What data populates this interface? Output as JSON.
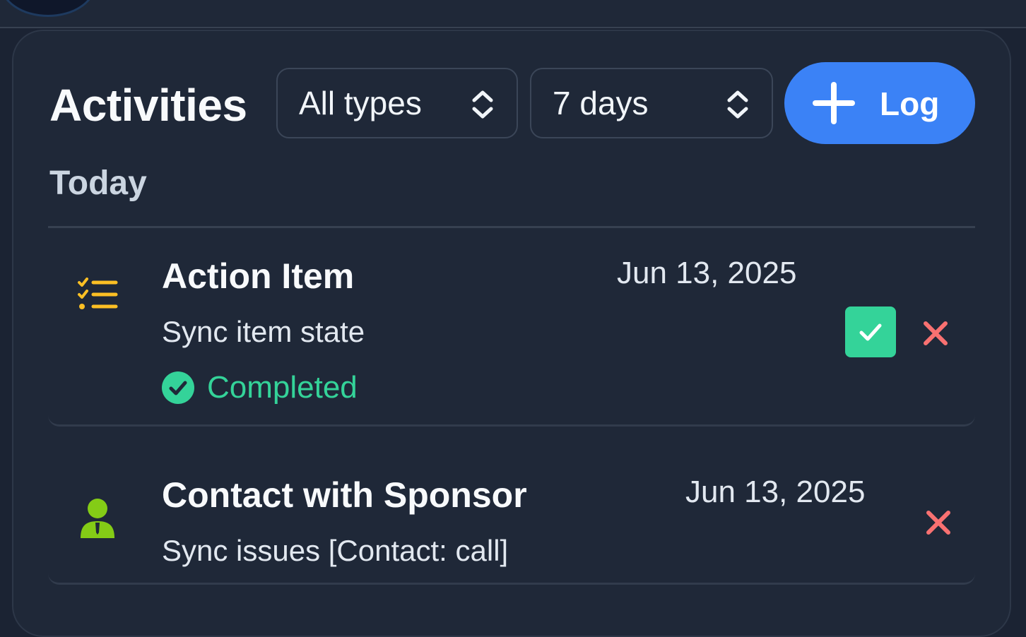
{
  "panel": {
    "title": "Activities",
    "filters": {
      "type_value": "All types",
      "range_value": "7 days"
    },
    "log_button": "Log"
  },
  "section": {
    "title": "Today"
  },
  "activities": [
    {
      "icon": "checklist-icon",
      "title": "Action Item",
      "description": "Sync item state",
      "date": "Jun 13, 2025",
      "status": "Completed"
    },
    {
      "icon": "person-icon",
      "title": "Contact with Sponsor",
      "description": "Sync issues [Contact: call]",
      "date": "Jun 13, 2025"
    }
  ],
  "colors": {
    "background": "#1f2838",
    "accent": "#3b82f6",
    "success": "#34d399",
    "danger": "#f87171",
    "checklist_icon": "#fbbf24",
    "person_icon": "#84cc16"
  }
}
